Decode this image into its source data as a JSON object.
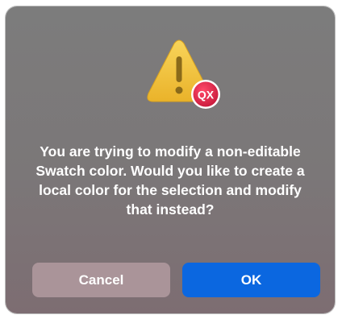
{
  "dialog": {
    "message": "You are trying to modify a non-editable Swatch color. Would you like to create a local color for the selection and modify that instead?",
    "icon": "warning-icon",
    "app_badge": "QX",
    "buttons": {
      "cancel_label": "Cancel",
      "ok_label": "OK"
    }
  },
  "colors": {
    "dialog_background": "#7b7778",
    "default_button": "#0b67e0",
    "cancel_button": "#aa9499",
    "warning_yellow": "#f3c33a",
    "badge_red": "#e0284a"
  }
}
